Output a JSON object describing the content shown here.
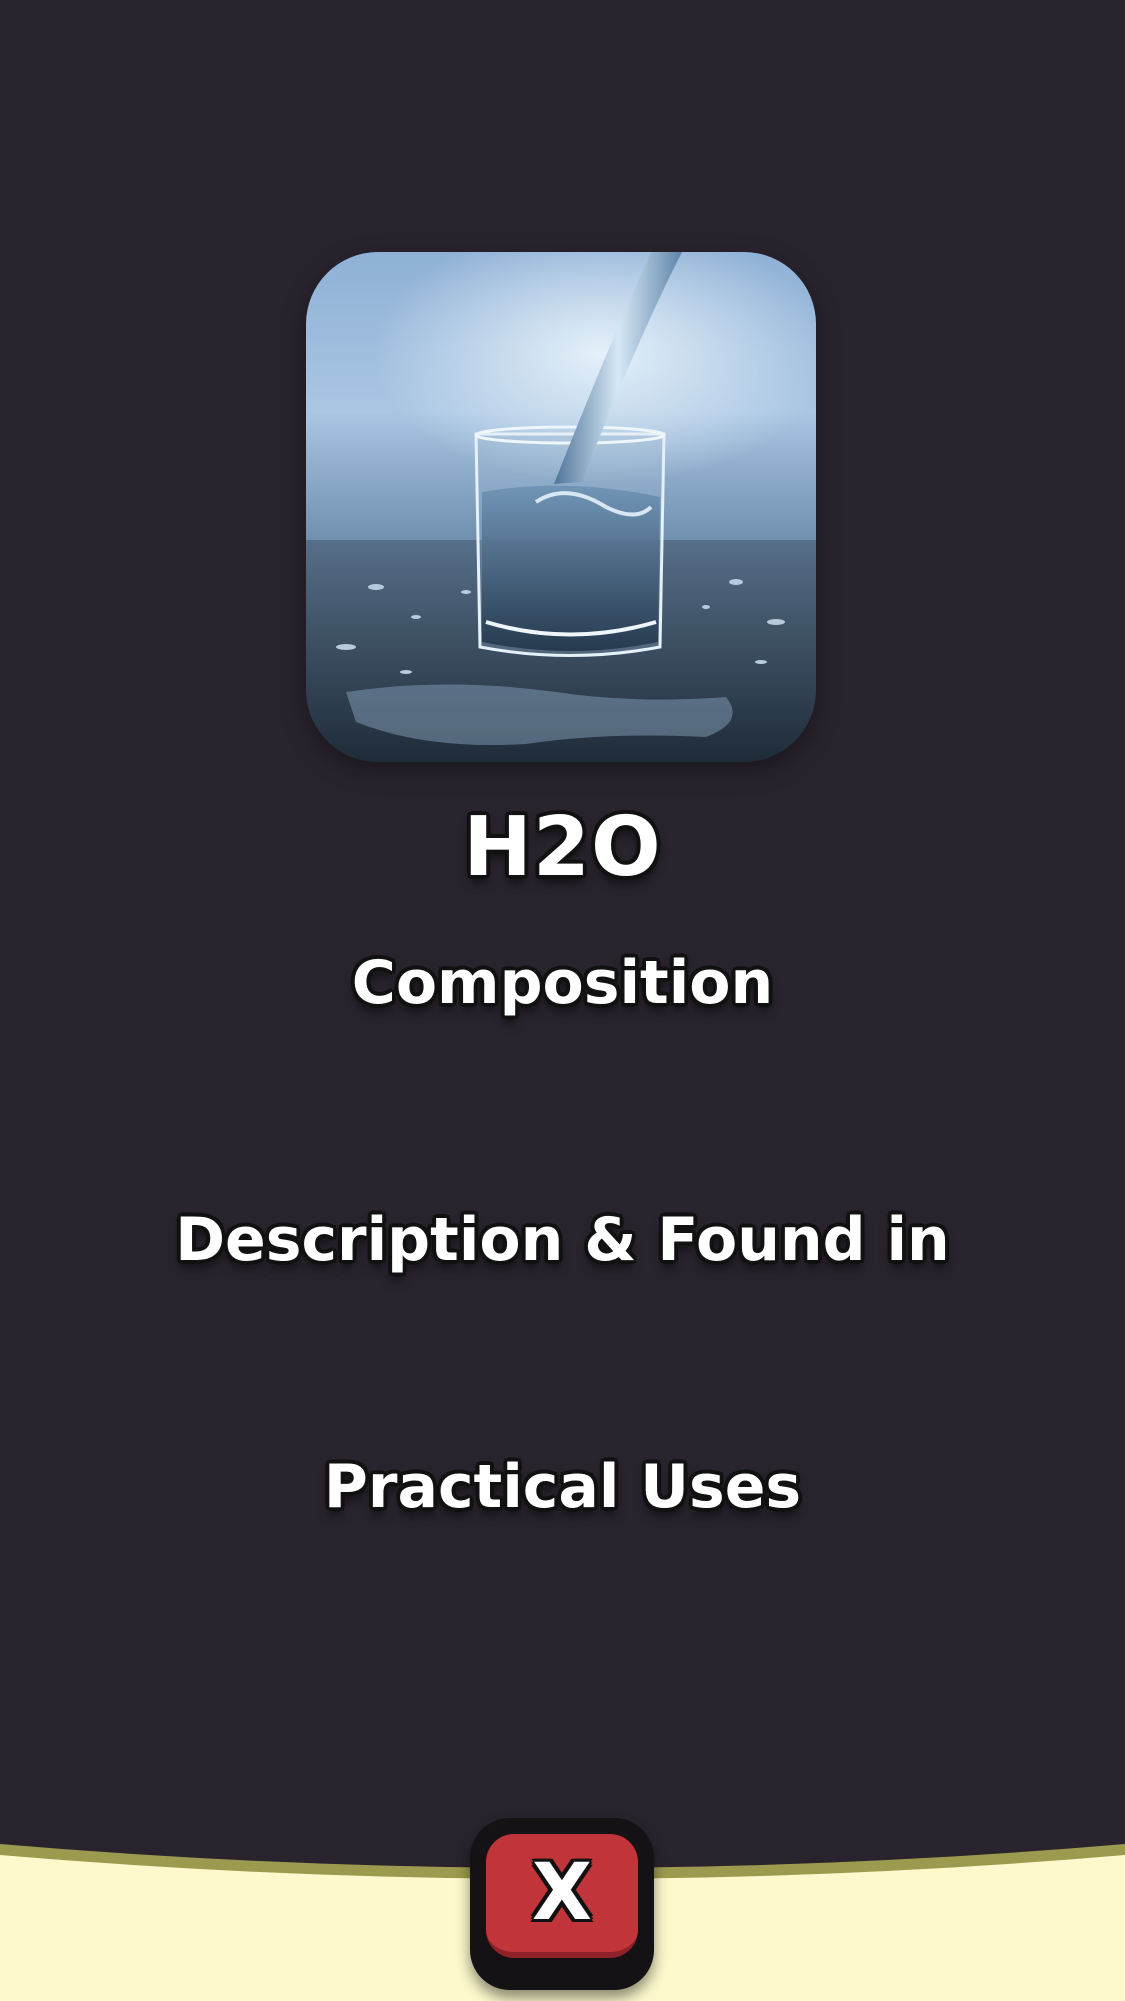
{
  "item": {
    "title": "H2O",
    "image_icon": "glass-of-water-image"
  },
  "sections": {
    "composition": "Composition",
    "description": "Description & Found in",
    "uses": "Practical Uses"
  },
  "close_button": {
    "label": "X"
  },
  "colors": {
    "background": "#29232d",
    "footer": "#fdf9cc",
    "footer_edge": "#9c9a4e",
    "close_button": "#c0343a"
  }
}
